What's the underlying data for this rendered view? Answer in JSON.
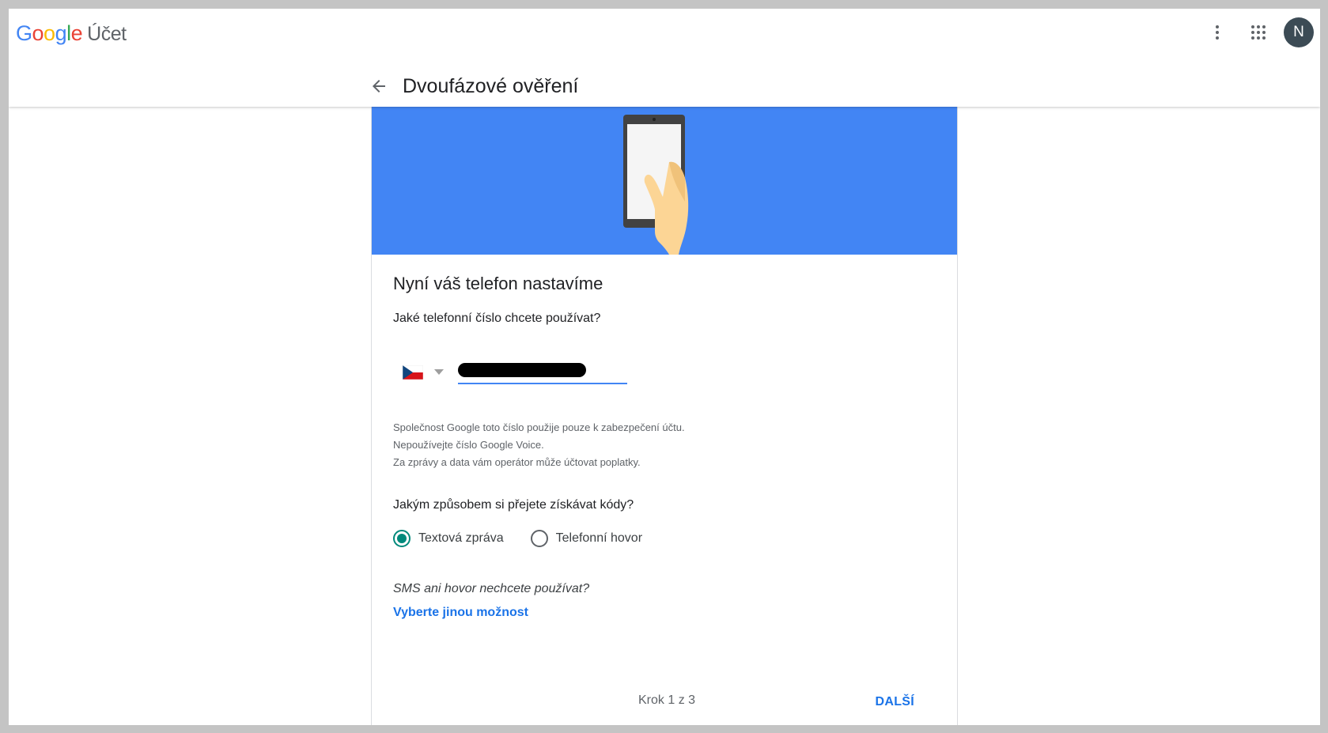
{
  "header": {
    "logo_letters": [
      "G",
      "o",
      "o",
      "g",
      "l",
      "e"
    ],
    "product": "Účet",
    "avatar_initial": "N",
    "more_icon": "more-vert-icon",
    "apps_icon": "apps-grid-icon"
  },
  "page": {
    "title": "Dvoufázové ověření",
    "back_icon": "arrow-back-icon"
  },
  "setup": {
    "title": "Nyní váš telefon nastavíme",
    "question": "Jaké telefonní číslo chcete používat?",
    "country_icon": "czech-flag-icon",
    "notes": [
      "Společnost Google toto číslo použije pouze k zabezpečení účtu.",
      "Nepoužívejte číslo Google Voice.",
      "Za zprávy a data vám operátor může účtovat poplatky."
    ],
    "codes_question": "Jakým způsobem si přejete získávat kódy?",
    "options": [
      {
        "label": "Textová zpráva",
        "selected": true
      },
      {
        "label": "Telefonní hovor",
        "selected": false
      }
    ],
    "alt_question": "SMS ani hovor nechcete používat?",
    "alt_link": "Vyberte jinou možnost"
  },
  "footer": {
    "step": "Krok 1 z 3",
    "next": "DALŠÍ"
  },
  "colors": {
    "hero": "#4285f4",
    "accent": "#1a73e8",
    "radio": "#00897b"
  }
}
